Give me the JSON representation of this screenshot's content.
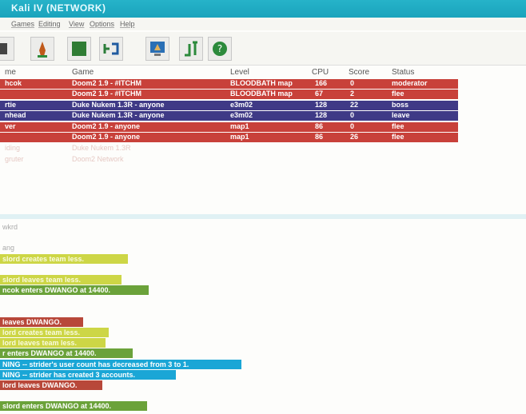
{
  "window": {
    "title": "Kali IV (NETWORK)"
  },
  "menu": [
    "Games",
    "Editing",
    "View",
    "Options",
    "Help"
  ],
  "toolbar": [
    {
      "icon": "doom-icon"
    },
    {
      "icon": "player-icon"
    },
    {
      "icon": "green-panel-icon"
    },
    {
      "icon": "connect-icon"
    },
    {
      "icon": "monitor-icon"
    },
    {
      "icon": "join-icon"
    },
    {
      "icon": "help-icon"
    }
  ],
  "table": {
    "headers": [
      "me",
      "Game",
      "Level",
      "CPU",
      "Score",
      "Status"
    ],
    "rows": [
      {
        "name": "hcok",
        "game": "Doom2 1.9 - #ITCHM",
        "level": "BLOODBATH map",
        "cpu": "166",
        "score": "0",
        "status": "moderator",
        "color": "red"
      },
      {
        "name": "",
        "game": "Doom2 1.9 - #ITCHM",
        "level": "BLOODBATH map",
        "cpu": "67",
        "score": "2",
        "status": "flee",
        "color": "red"
      },
      {
        "name": "rtie",
        "game": "Duke Nukem 1.3R - anyone",
        "level": "e3m02",
        "cpu": "128",
        "score": "22",
        "status": "boss",
        "color": "blue"
      },
      {
        "name": "nhead",
        "game": "Duke Nukem 1.3R - anyone",
        "level": "e3m02",
        "cpu": "128",
        "score": "0",
        "status": "leave",
        "color": "blue"
      },
      {
        "name": "ver",
        "game": "Doom2 1.9 - anyone",
        "level": "map1",
        "cpu": "86",
        "score": "0",
        "status": "flee",
        "color": "red"
      },
      {
        "name": "",
        "game": "Doom2 1.9 - anyone",
        "level": "map1",
        "cpu": "86",
        "score": "26",
        "status": "flee",
        "color": "red"
      },
      {
        "name": "iding",
        "game": "Duke Nukem 1.3R",
        "level": "",
        "cpu": "",
        "score": "",
        "status": "",
        "color": "faint"
      },
      {
        "name": "gruter",
        "game": "Doom2 Network",
        "level": "",
        "cpu": "",
        "score": "",
        "status": "",
        "color": "faint"
      }
    ]
  },
  "log": [
    {
      "text": "wkrd",
      "style": "faint"
    },
    {
      "text": "",
      "style": "faint"
    },
    {
      "text": "ang",
      "style": "faint"
    },
    {
      "text": "slord creates team less.",
      "style": "yellow"
    },
    {
      "text": "",
      "style": "faint"
    },
    {
      "text": "slord leaves team less.",
      "style": "yellow"
    },
    {
      "text": "ncok enters DWANGO at 14400.",
      "style": "green"
    },
    {
      "text": "",
      "style": "faint"
    },
    {
      "text": "",
      "style": "faint"
    },
    {
      "text": "leaves DWANGO.",
      "style": "red"
    },
    {
      "text": "lord creates team less.",
      "style": "yellow"
    },
    {
      "text": "lord leaves team less.",
      "style": "yellow"
    },
    {
      "text": "r enters DWANGO at 14400.",
      "style": "green"
    },
    {
      "text": "NING -- strider's user count has decreased from 3 to 1.",
      "style": "cyan"
    },
    {
      "text": "NING -- strider has created 3 accounts.",
      "style": "cyan"
    },
    {
      "text": "lord leaves DWANGO.",
      "style": "red"
    },
    {
      "text": "",
      "style": "faint"
    },
    {
      "text": "slord enters DWANGO at 14400.",
      "style": "green"
    }
  ]
}
